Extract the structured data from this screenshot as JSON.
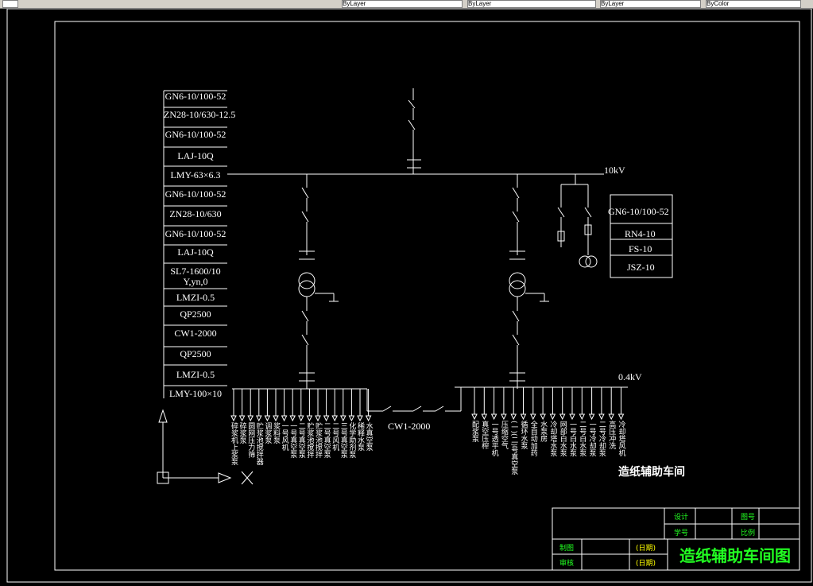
{
  "toolbar": {
    "dropdowns": [
      "ByLayer",
      "ByLayer",
      "ByLayer",
      "ByColor"
    ]
  },
  "left_specs": [
    "GN6-10/100-52",
    "ZN28-10/630-12.5",
    "GN6-10/100-52",
    "LAJ-10Q",
    "LMY-63×6.3",
    "GN6-10/100-52",
    "ZN28-10/630",
    "GN6-10/100-52",
    "LAJ-10Q",
    "SL7-1600/10",
    "Y,yn,0",
    "LMZI-0.5",
    "QP2500",
    "CW1-2000",
    "QP2500",
    "LMZI-0.5",
    "LMY-100×10"
  ],
  "right_specs": [
    "GN6-10/100-52",
    "RN4-10",
    "FS-10",
    "JSZ-10"
  ],
  "bus_hv_label": "10kV",
  "bus_lv_label": "0.4kV",
  "tie_label": "CW1-2000",
  "workshop_label": "造纸辅助车间",
  "left_feeders": [
    "碎浆机上浆泵",
    "碎浆泵",
    "圆网压力筛",
    "贮浆池搅拌器",
    "调浆泵",
    "浆料泵",
    "一号风机",
    "一号真空泵",
    "二号真空泵",
    "贮浆池搅拌",
    "贮浆池搅拌",
    "二号真空泵",
    "二号风机",
    "三号真空泵",
    "化学助剂泵",
    "稀释水泵",
    "水真空泵"
  ],
  "right_feeders": [
    "配浆泵",
    "真空压榨",
    "一号透平机",
    "压缩空气",
    "(一)(二)号真空泵",
    "循环水泵",
    "全自动加药",
    "水泵房",
    "冷却塔水泵",
    "网部白水泵",
    "一号白水泵",
    "二号白水泵",
    "一号冷却泵",
    "二号冷却泵",
    "高压冲洗",
    "冷却塔风机"
  ],
  "title_block": {
    "label_design": "设计",
    "label_student_id": "学号",
    "label_drawn": "制图",
    "label_checked": "审核",
    "label_drawing_no": "图号",
    "label_scale": "比例",
    "date1": "(日期)",
    "date2": "(日期)",
    "title": "造纸辅助车间图"
  },
  "colors": {
    "lines": "#ffffff",
    "title_text": "#22ff22",
    "date_text": "#ffff00",
    "background": "#000000"
  }
}
